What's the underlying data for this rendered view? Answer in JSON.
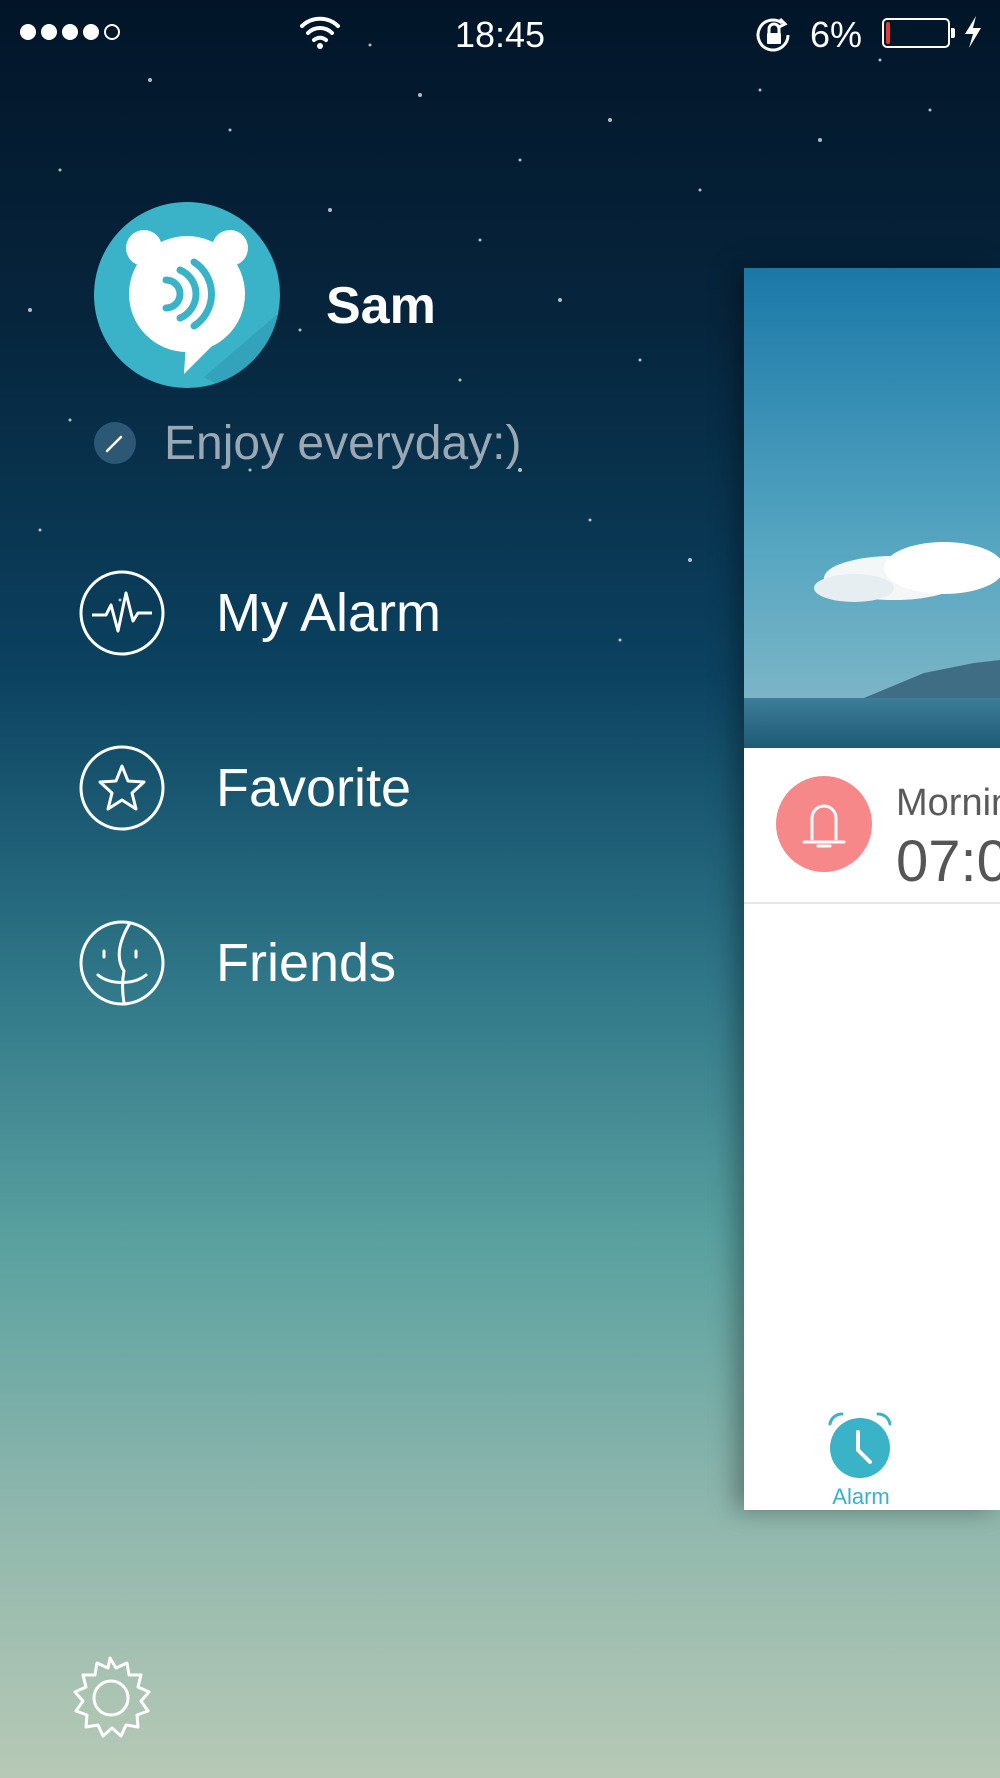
{
  "status_bar": {
    "time": "18:45",
    "battery_percent": "6%",
    "battery_level": 0.06,
    "signal_bars": 4,
    "signal_total": 5
  },
  "profile": {
    "name": "Sam",
    "tagline": "Enjoy everyday:)"
  },
  "menu": {
    "items": [
      {
        "label": "My Alarm",
        "icon": "pulse-icon"
      },
      {
        "label": "Favorite",
        "icon": "star-icon"
      },
      {
        "label": "Friends",
        "icon": "face-icon"
      }
    ]
  },
  "settings": {
    "icon": "gear-icon"
  },
  "card": {
    "alarm_name": "Mornin",
    "alarm_time": "07:0",
    "tab_label": "Alarm"
  },
  "colors": {
    "accent": "#3ab2c8",
    "alarm_bell": "#f7888a",
    "battery_low": "#e23a3a"
  }
}
